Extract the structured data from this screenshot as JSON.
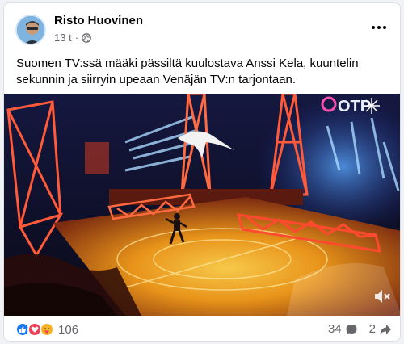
{
  "post": {
    "author": "Risto Huovinen",
    "time": "13 t",
    "separator": "·",
    "text": "Suomen TV:ssä määki pässiltä kuulostava Anssi Kela, kuuntelin sekunnin ja siirryin upeaan Venäjän TV:n tarjontaan."
  },
  "video": {
    "channel_logo": "ОТР"
  },
  "footer": {
    "reaction_count": "106",
    "comment_count": "34",
    "share_count": "2"
  },
  "icons": {
    "like": "like-icon",
    "love": "love-icon",
    "care": "care-icon",
    "comment": "comment-icon",
    "share": "share-icon",
    "globe": "globe-icon",
    "mute": "mute-icon"
  },
  "colors": {
    "like_blue": "#1877f2",
    "love_red": "#f33e58",
    "care_yellow": "#f7b125",
    "stage_orange": "#e8a11a",
    "stage_red": "#e0402a"
  }
}
